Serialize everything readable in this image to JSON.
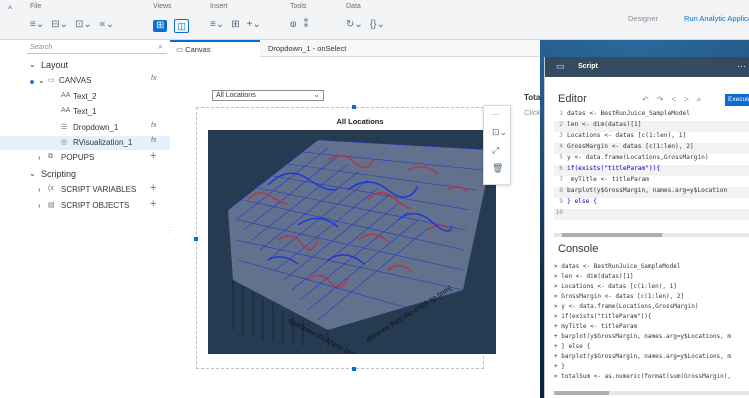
{
  "ribbon": {
    "file_label": "File",
    "views_label": "Views",
    "insert_label": "Insert",
    "tools_label": "Tools",
    "data_label": "Data",
    "designer_label": "Designer",
    "run_label": "Run Analytic Applica"
  },
  "search": {
    "placeholder": "Search"
  },
  "tree": {
    "layout": "Layout",
    "canvas": "CANVAS",
    "text2": "Text_2",
    "text1": "Text_1",
    "dropdown": "Dropdown_1",
    "rviz": "RVisualization_1",
    "popups": "POPUPS",
    "scripting": "Scripting",
    "script_vars": "SCRIPT VARIABLES",
    "script_objs": "SCRIPT OBJECTS",
    "fx": "fx",
    "aa": "AA"
  },
  "tabs": {
    "canvas": "Canvas",
    "onselect": "Dropdown_1 - onSelect"
  },
  "canvas": {
    "dropdown_value": "All Locations",
    "chart_title": "All Locations",
    "total_label": "Tota",
    "click_label": "Click",
    "y_axis_label": "distance from the crack tip [mm]",
    "x_axis_label": "specimen thickness [mm]"
  },
  "script": {
    "panel_title": "Script",
    "editor_title": "Editor",
    "execute_label": "Execute",
    "console_title": "Console",
    "code_lines": [
      {
        "n": "1",
        "text": "datas <- BestRunJuice_SampleModel"
      },
      {
        "n": "2",
        "text": "len <- dim(datas)[1]"
      },
      {
        "n": "3",
        "text": "Locations <- datas [c(1:len), 1]"
      },
      {
        "n": "4",
        "text": "GrossMargin <- datas [c(1:len), 2]"
      },
      {
        "n": "5",
        "text": "y <- data.frame(Locations,GrossMargin)"
      },
      {
        "n": "6",
        "text": "if(exists(\"titleParam\")){"
      },
      {
        "n": "7",
        "text": "   myTitle <- titleParam"
      },
      {
        "n": "8",
        "text": "barplot(y$GrossMargin, names.arg=y$Location"
      },
      {
        "n": "9",
        "text": "} else {"
      },
      {
        "n": "10",
        "text": ""
      }
    ],
    "console_lines": [
      "> datas <- BestRunJuice_SampleModel",
      "> len <- dim(datas)[1]",
      "> Locations <- datas [c(1:len), 1]",
      "> GrossMargin <- datas [c(1:len), 2]",
      "> y <- data.frame(Locations,GrossMargin)",
      "> if(exists(\"titleParam\")){",
      "+    myTitle <- titleParam",
      "+ barplot(y$GrossMargin, names.arg=y$Locations, m",
      "+ } else {",
      "+ barplot(y$GrossMargin, names.arg=y$Locations, m",
      "+ }",
      "> totalSum <- as.numeric(format(sum(GrossMargin),"
    ]
  }
}
